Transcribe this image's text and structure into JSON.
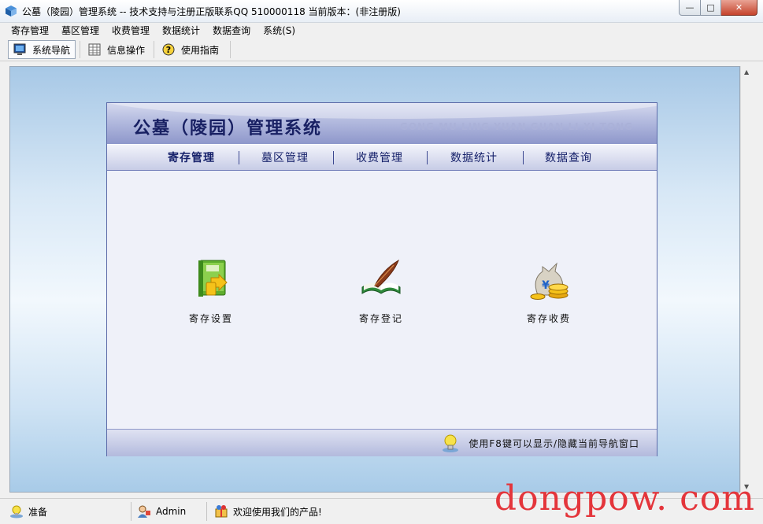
{
  "window": {
    "title": "公墓（陵园）管理系统 -- 技术支持与注册正版联系QQ 510000118    当前版本：(非注册版)",
    "minimize": "—",
    "maximize": "□",
    "close": "✕"
  },
  "menubar": [
    "寄存管理",
    "墓区管理",
    "收费管理",
    "数据统计",
    "数据查询",
    "系统(S)"
  ],
  "toolbar": {
    "nav": "系统导航",
    "info": "信息操作",
    "guide": "使用指南"
  },
  "panel": {
    "title": "公墓（陵园）管理系统",
    "pinyin": "GONG MU LING YUAN GUAN LI XI TONG",
    "nav": [
      "寄存管理",
      "墓区管理",
      "收费管理",
      "数据统计",
      "数据查询"
    ],
    "active_nav": "寄存管理",
    "features": [
      {
        "label": "寄存设置",
        "icon": "book-settings-icon"
      },
      {
        "label": "寄存登记",
        "icon": "quill-book-icon"
      },
      {
        "label": "寄存收费",
        "icon": "money-bag-icon"
      }
    ],
    "footer_tip": "使用F8键可以显示/隐藏当前导航窗口"
  },
  "statusbar": {
    "ready": "准备",
    "user": "Admin",
    "message": "欢迎使用我们的产品!"
  },
  "watermark": "dongpow. com",
  "colors": {
    "panel_title": "#182063",
    "panel_border": "#5c6aa8",
    "watermark": "#e4353b"
  }
}
